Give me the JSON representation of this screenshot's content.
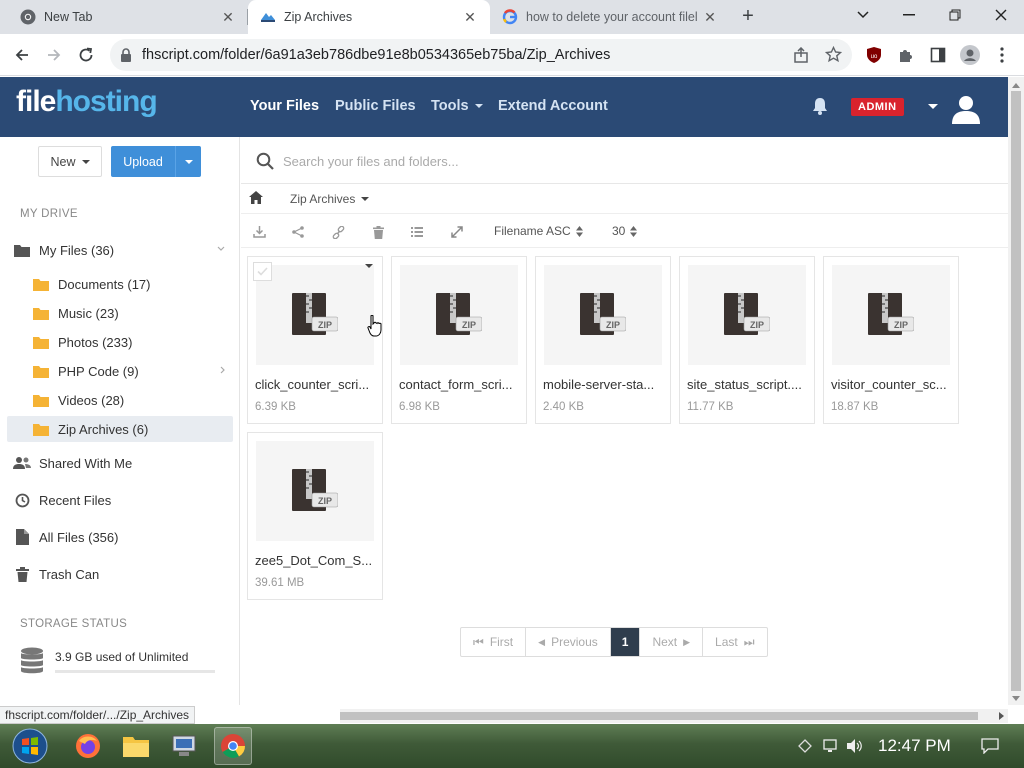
{
  "browser": {
    "tabs": [
      {
        "title": "New Tab",
        "icon": "chrome-icon"
      },
      {
        "title": "Zip Archives",
        "icon": "filehosting-icon"
      },
      {
        "title": "how to delete your account filel",
        "icon": "google-icon"
      }
    ],
    "url": "fhscript.com/folder/6a91a3eb786dbe91e8b0534365eb75ba/Zip_Archives",
    "status_url": "fhscript.com/folder/.../Zip_Archives"
  },
  "app": {
    "logo_part1": "file",
    "logo_part2": "hosting",
    "nav": [
      "Your Files",
      "Public Files",
      "Tools",
      "Extend Account"
    ],
    "admin_badge": "ADMIN"
  },
  "sidebar": {
    "new_label": "New",
    "upload_label": "Upload",
    "section_drive": "MY DRIVE",
    "my_files": "My Files (36)",
    "folders": [
      "Documents (17)",
      "Music (23)",
      "Photos (233)",
      "PHP Code (9)",
      "Videos (28)",
      "Zip Archives (6)"
    ],
    "links": [
      "Shared With Me",
      "Recent Files",
      "All Files (356)",
      "Trash Can"
    ],
    "section_storage": "STORAGE STATUS",
    "storage_text": "3.9 GB used of Unlimited"
  },
  "main": {
    "search_placeholder": "Search your files and folders...",
    "breadcrumb": "Zip Archives",
    "sort": "Filename ASC",
    "per_page": "30",
    "zip_badge": "ZIP",
    "files": [
      {
        "name": "click_counter_scri...",
        "size": "6.39 KB"
      },
      {
        "name": "contact_form_scri...",
        "size": "6.98 KB"
      },
      {
        "name": "mobile-server-sta...",
        "size": "2.40 KB"
      },
      {
        "name": "site_status_script....",
        "size": "11.77 KB"
      },
      {
        "name": "visitor_counter_sc...",
        "size": "18.87 KB"
      },
      {
        "name": "zee5_Dot_Com_S...",
        "size": "39.61 MB"
      }
    ],
    "pager": {
      "first": "First",
      "prev": "Previous",
      "current": "1",
      "next": "Next",
      "last": "Last"
    }
  },
  "taskbar": {
    "time": "12:47 PM"
  },
  "colors": {
    "header": "#2b4a75",
    "accent": "#3f8fd9",
    "badge": "#d9232d",
    "logo_blue": "#56b6ea"
  }
}
